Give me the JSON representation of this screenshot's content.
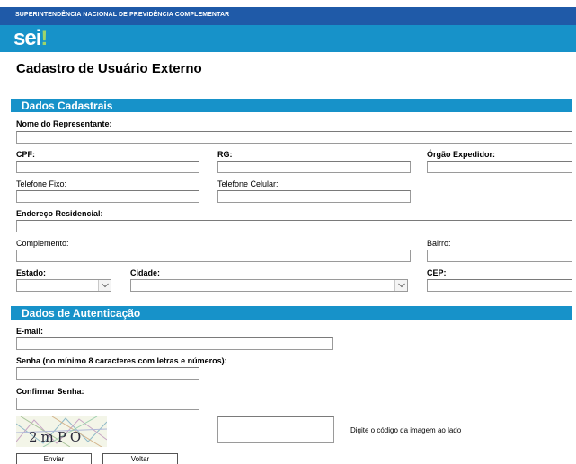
{
  "header": {
    "agency": "SUPERINTENDÊNCIA NACIONAL DE PREVIDÊNCIA COMPLEMENTAR",
    "logo_text": "sei",
    "logo_mark": "!"
  },
  "page_title": "Cadastro de Usuário Externo",
  "sections": {
    "dados_cadastrais": "Dados Cadastrais",
    "dados_autenticacao": "Dados de Autenticação"
  },
  "fields": {
    "nome_representante": {
      "label": "Nome do Representante:",
      "value": ""
    },
    "cpf": {
      "label": "CPF:",
      "value": ""
    },
    "rg": {
      "label": "RG:",
      "value": ""
    },
    "orgao_expedidor": {
      "label": "Órgão Expedidor:",
      "value": ""
    },
    "telefone_fixo": {
      "label": "Telefone Fixo:",
      "value": ""
    },
    "telefone_celular": {
      "label": "Telefone Celular:",
      "value": ""
    },
    "endereco": {
      "label": "Endereço Residencial:",
      "value": ""
    },
    "complemento": {
      "label": "Complemento:",
      "value": ""
    },
    "bairro": {
      "label": "Bairro:",
      "value": ""
    },
    "estado": {
      "label": "Estado:",
      "selected": ""
    },
    "cidade": {
      "label": "Cidade:",
      "selected": ""
    },
    "cep": {
      "label": "CEP:",
      "value": ""
    },
    "email": {
      "label": "E-mail:",
      "value": ""
    },
    "senha": {
      "label": "Senha (no mínimo 8 caracteres com letras e números):",
      "value": ""
    },
    "confirmar_senha": {
      "label": "Confirmar Senha:",
      "value": ""
    },
    "captcha_code": {
      "value": ""
    }
  },
  "captcha": {
    "text": "2mPO",
    "hint": "Digite o código da imagem ao lado"
  },
  "buttons": {
    "enviar": "Enviar",
    "voltar": "Voltar"
  },
  "colors": {
    "header_dark": "#1f5aa8",
    "header_light": "#1792c9",
    "logo_accent": "#9ed46a"
  }
}
